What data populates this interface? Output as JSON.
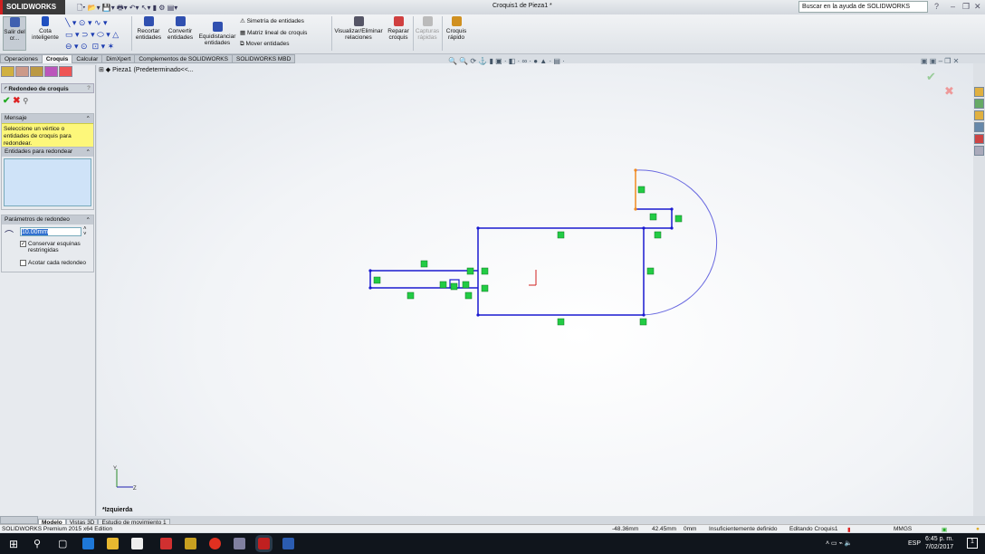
{
  "app": {
    "logo": "SOLIDWORKS",
    "title": "Croquis1 de Pieza1 *",
    "help_search_placeholder": "Buscar en la ayuda de SOLIDWORKS"
  },
  "ribbon": {
    "exit_sketch": "Salir del cr...",
    "smart_dim": "Cota inteligente",
    "trim": "Recortar entidades",
    "convert": "Convertir entidades",
    "offset": "Equidistanciar entidades",
    "mirror": "Simetría de entidades",
    "linear_pattern": "Matriz lineal de croquis",
    "move": "Mover entidades",
    "relations": "Visualizar/Eliminar relaciones",
    "repair": "Reparar croquis",
    "quick_snaps": "Capturas rápidas",
    "rapid_sketch": "Croquis rápido"
  },
  "tabs": [
    "Operaciones",
    "Croquis",
    "Calcular",
    "DimXpert",
    "Complementos de SOLIDWORKS",
    "SOLIDWORKS MBD"
  ],
  "tree": {
    "item": "Pieza1 (Predeterminado<<..."
  },
  "panel": {
    "title": "Redondeo de croquis",
    "help": "?",
    "message_header": "Mensaje",
    "message": "Seleccione un vértice o entidades de croquis para redondear.",
    "entities_header": "Entidades para redondear",
    "params_header": "Parámetros de redondeo",
    "radius": "10.00mm",
    "keep_corners": "Conservar esquinas restringidas",
    "keep_corners_checked": true,
    "dim_each": "Acotar cada redondeo",
    "dim_each_checked": false
  },
  "view": {
    "orientation": "*Izquierda"
  },
  "bottom_tabs": [
    "Modelo",
    "Vistas 3D",
    "Estudio de movimiento 1"
  ],
  "status": {
    "edition": "SOLIDWORKS Premium 2015 x64 Edition",
    "x": "-48.36mm",
    "y": "42.45mm",
    "z": "0mm",
    "state": "Insuficientemente definido",
    "mode": "Editando Croquis1",
    "units": "MMGS"
  },
  "taskbar": {
    "lang": "ESP",
    "time": "6:45 p. m.",
    "date": "7/02/2017",
    "notifications": "1"
  },
  "colors": {
    "sketch": "#1a1ad0",
    "selected": "#f08a20",
    "relation": "#22cc44"
  }
}
